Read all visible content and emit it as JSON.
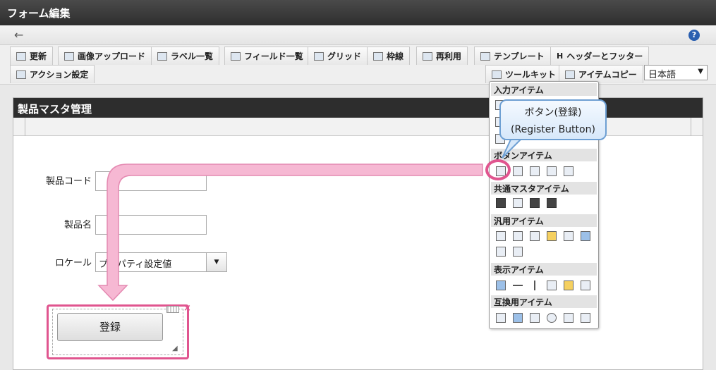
{
  "window": {
    "title": "フォーム編集"
  },
  "nav": {
    "back_icon": "←",
    "help_icon": "?"
  },
  "toolbar": {
    "row1": [
      {
        "label": "更新"
      },
      {
        "label": "画像アップロード"
      },
      {
        "label": "ラベル一覧"
      },
      {
        "label": "フィールド一覧"
      },
      {
        "label": "グリッド"
      },
      {
        "label": "枠線"
      },
      {
        "label": "再利用"
      },
      {
        "label": "テンプレート"
      },
      {
        "label": "ヘッダーとフッター"
      }
    ],
    "row2": [
      {
        "label": "アクション設定"
      },
      {
        "label": "ツールキット"
      },
      {
        "label": "アイテムコピー"
      }
    ],
    "language": "日本語"
  },
  "form": {
    "title": "製品マスタ管理",
    "fields": [
      {
        "label": "製品コード",
        "value": ""
      },
      {
        "label": "製品名",
        "value": ""
      },
      {
        "label": "ロケール",
        "value": "プロパティ設定値"
      }
    ],
    "register_button": "登録"
  },
  "palette": {
    "sections": [
      {
        "title": "入力アイテム"
      },
      {
        "title": "ボタンアイテム"
      },
      {
        "title": "共通マスタアイテム"
      },
      {
        "title": "汎用アイテム"
      },
      {
        "title": "表示アイテム"
      },
      {
        "title": "互換用アイテム"
      }
    ]
  },
  "callout": {
    "line1": "ボタン(登録)",
    "line2": "(Register Button)"
  },
  "colors": {
    "accent": "#e0558f",
    "callout_border": "#6d9fd3",
    "header": "#2d2d2d"
  }
}
